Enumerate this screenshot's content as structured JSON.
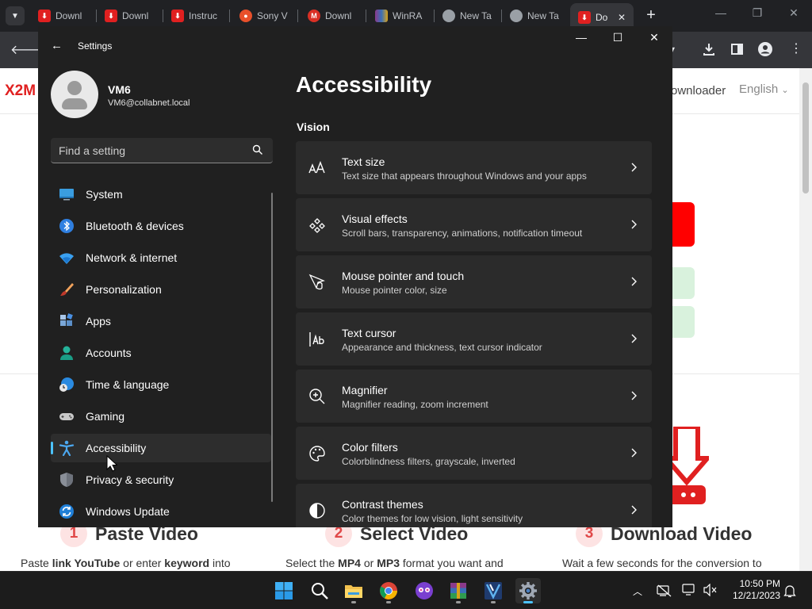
{
  "browser": {
    "tabs": [
      {
        "label": "Downl",
        "favicon": "x2mate-icon",
        "color": "#e02020"
      },
      {
        "label": "Downl",
        "favicon": "x2mate-icon",
        "color": "#e02020"
      },
      {
        "label": "Instruc",
        "favicon": "x2mate-icon",
        "color": "#e02020"
      },
      {
        "label": "Sony V",
        "favicon": "sony-icon",
        "color": "#e8502a"
      },
      {
        "label": "Downl",
        "favicon": "gmail-icon",
        "color": "#d93025"
      },
      {
        "label": "WinRA",
        "favicon": "winrar-icon",
        "color": "#8b3a8b"
      },
      {
        "label": "New Ta",
        "favicon": "chrome-icon",
        "color": "#9aa0a6"
      },
      {
        "label": "New Ta",
        "favicon": "chrome-icon",
        "color": "#9aa0a6"
      },
      {
        "label": "Do",
        "favicon": "x2mate-icon",
        "color": "#e02020",
        "active": true
      }
    ],
    "new_tab": "+"
  },
  "webpage": {
    "logo": "X2M",
    "nav_downloader": "ownloader",
    "language": "English",
    "steps": [
      {
        "num": "1",
        "title": "Paste Video"
      },
      {
        "num": "2",
        "title": "Select Video"
      },
      {
        "num": "3",
        "title": "Download Video"
      }
    ],
    "desc1_a": "Paste ",
    "desc1_b": "link YouTube",
    "desc1_c": " or enter ",
    "desc1_d": "keyword",
    "desc1_e": " into",
    "desc2_a": "Select the ",
    "desc2_b": "MP4",
    "desc2_c": " or ",
    "desc2_d": "MP3",
    "desc2_e": " format you want and",
    "desc3": "Wait a few seconds for the conversion to"
  },
  "settings": {
    "window_title": "Settings",
    "user": {
      "name": "VM6",
      "email": "VM6@collabnet.local"
    },
    "search": {
      "placeholder": "Find a setting"
    },
    "nav": [
      {
        "label": "System",
        "icon": "system-icon"
      },
      {
        "label": "Bluetooth & devices",
        "icon": "bluetooth-icon"
      },
      {
        "label": "Network & internet",
        "icon": "network-icon"
      },
      {
        "label": "Personalization",
        "icon": "brush-icon"
      },
      {
        "label": "Apps",
        "icon": "apps-icon"
      },
      {
        "label": "Accounts",
        "icon": "accounts-icon"
      },
      {
        "label": "Time & language",
        "icon": "time-language-icon"
      },
      {
        "label": "Gaming",
        "icon": "gaming-icon"
      },
      {
        "label": "Accessibility",
        "icon": "accessibility-icon",
        "selected": true
      },
      {
        "label": "Privacy & security",
        "icon": "shield-icon"
      },
      {
        "label": "Windows Update",
        "icon": "windows-update-icon"
      }
    ],
    "page_title": "Accessibility",
    "section": "Vision",
    "cards": [
      {
        "title": "Text size",
        "desc": "Text size that appears throughout Windows and your apps",
        "icon": "text-size-icon"
      },
      {
        "title": "Visual effects",
        "desc": "Scroll bars, transparency, animations, notification timeout",
        "icon": "visual-effects-icon"
      },
      {
        "title": "Mouse pointer and touch",
        "desc": "Mouse pointer color, size",
        "icon": "mouse-pointer-icon"
      },
      {
        "title": "Text cursor",
        "desc": "Appearance and thickness, text cursor indicator",
        "icon": "text-cursor-icon"
      },
      {
        "title": "Magnifier",
        "desc": "Magnifier reading, zoom increment",
        "icon": "magnifier-icon"
      },
      {
        "title": "Color filters",
        "desc": "Colorblindness filters, grayscale, inverted",
        "icon": "color-filters-icon"
      },
      {
        "title": "Contrast themes",
        "desc": "Color themes for low vision, light sensitivity",
        "icon": "contrast-themes-icon"
      }
    ],
    "accent": "#4cc2ff"
  },
  "taskbar": {
    "apps": [
      "start-icon",
      "search-icon",
      "file-explorer-icon",
      "chrome-icon",
      "media-app-icon",
      "winrar-icon",
      "app-icon",
      "settings-icon"
    ],
    "clock": {
      "time": "10:50 PM",
      "date": "12/21/2023"
    }
  }
}
